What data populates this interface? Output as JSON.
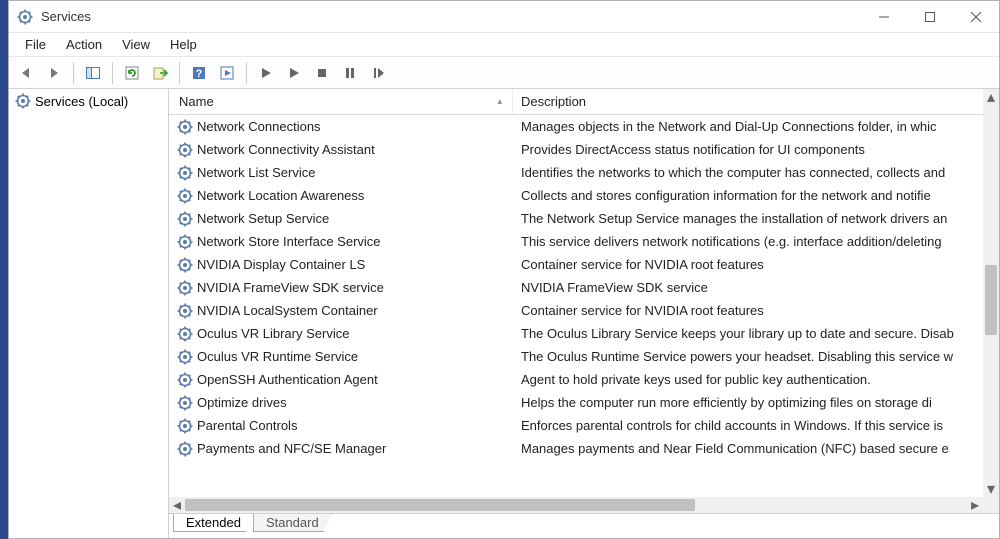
{
  "window": {
    "title": "Services"
  },
  "menubar": {
    "file": "File",
    "action": "Action",
    "view": "View",
    "help": "Help"
  },
  "tree": {
    "root_label": "Services (Local)"
  },
  "columns": {
    "name": "Name",
    "description": "Description"
  },
  "tabs": {
    "extended": "Extended",
    "standard": "Standard"
  },
  "services": [
    {
      "name": "Network Connections",
      "desc": "Manages objects in the Network and Dial-Up Connections folder, in whic"
    },
    {
      "name": "Network Connectivity Assistant",
      "desc": "Provides DirectAccess status notification for UI components"
    },
    {
      "name": "Network List Service",
      "desc": "Identifies the networks to which the computer has connected, collects and"
    },
    {
      "name": "Network Location Awareness",
      "desc": "Collects and stores configuration information for the network and notifie"
    },
    {
      "name": "Network Setup Service",
      "desc": "The Network Setup Service manages the installation of network drivers an"
    },
    {
      "name": "Network Store Interface Service",
      "desc": "This service delivers network notifications (e.g. interface addition/deleting"
    },
    {
      "name": "NVIDIA Display Container LS",
      "desc": "Container service for NVIDIA root features"
    },
    {
      "name": "NVIDIA FrameView SDK service",
      "desc": "NVIDIA FrameView SDK service"
    },
    {
      "name": "NVIDIA LocalSystem Container",
      "desc": "Container service for NVIDIA root features"
    },
    {
      "name": "Oculus VR Library Service",
      "desc": "The Oculus Library Service keeps your library up to date and secure. Disab"
    },
    {
      "name": "Oculus VR Runtime Service",
      "desc": "The Oculus Runtime Service powers your headset. Disabling this service w"
    },
    {
      "name": "OpenSSH Authentication Agent",
      "desc": "Agent to hold private keys used for public key authentication."
    },
    {
      "name": "Optimize drives",
      "desc": "Helps the computer run more efficiently by optimizing files on storage di"
    },
    {
      "name": "Parental Controls",
      "desc": "Enforces parental controls for child accounts in Windows. If this service is"
    },
    {
      "name": "Payments and NFC/SE Manager",
      "desc": "Manages payments and Near Field Communication (NFC) based secure e"
    }
  ]
}
